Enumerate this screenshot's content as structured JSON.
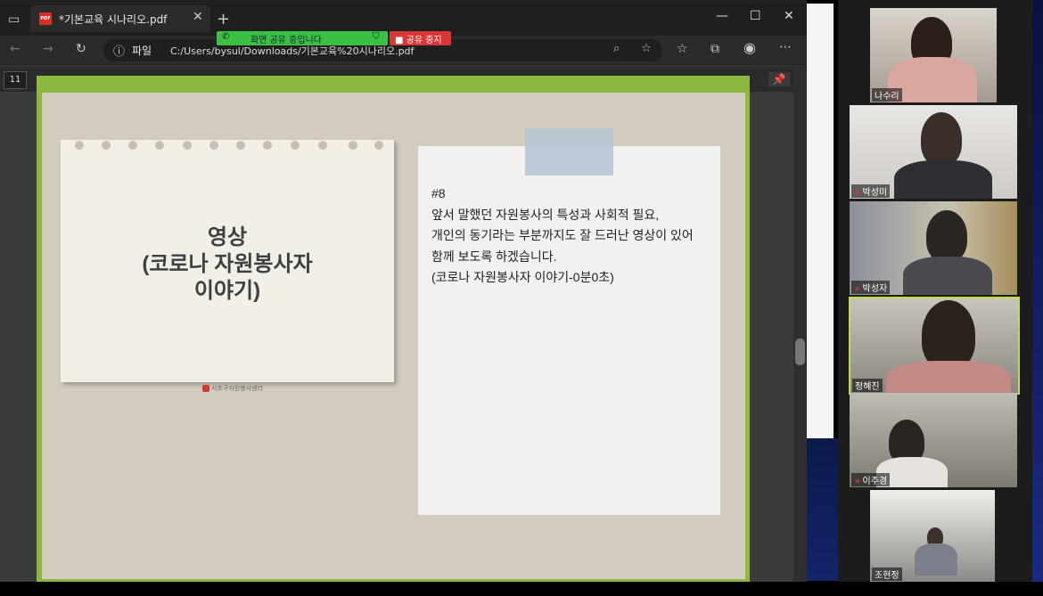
{
  "browser": {
    "tab_title": "*기본교육 시나리오.pdf",
    "tab_icon": "PDF",
    "address_prefix": "파일",
    "address": "C:/Users/bysul/Downloads/기본교육%20시나리오.pdf",
    "page_number": "11"
  },
  "share_banner": {
    "status": "화면 공유 중입니다",
    "stop_label": "공유 중지"
  },
  "slide": {
    "heading_line1": "영상",
    "heading_line2": "(코로나 자원봉사자",
    "heading_line3": "이야기)",
    "logo_text": "서초구자원봉사센터",
    "notes": [
      "#8",
      "앞서 말했던 자원봉사의 특성과 사회적 필요,",
      "개인의 동기라는 부분까지도 잘 드러난 영상이 있어",
      "함께 보도록 하겠습니다.",
      "(코로나 자원봉사자 이야기-0분0초)"
    ]
  },
  "participants": [
    {
      "name": "나수리",
      "muted": false
    },
    {
      "name": "박성미",
      "muted": true
    },
    {
      "name": "박성자",
      "muted": true
    },
    {
      "name": "정혜진",
      "muted": false,
      "speaking": true
    },
    {
      "name": "이주경",
      "muted": true
    },
    {
      "name": "조현정",
      "muted": false
    }
  ],
  "colors": {
    "slide_border": "#8cb83f",
    "slide_bg": "#d3cbbd",
    "share_green": "#3cc043",
    "stop_red": "#d93636",
    "speaker_highlight": "#c7d94a"
  }
}
